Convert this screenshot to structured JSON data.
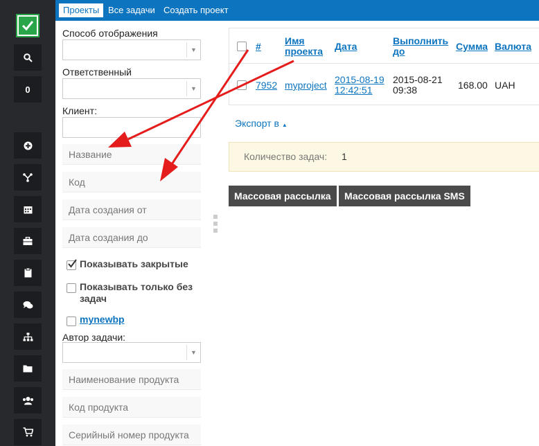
{
  "sidebar": {
    "counter": "0",
    "icons": [
      "check-logo-icon",
      "search-icon",
      "plus-circle-icon",
      "fork-icon",
      "calendar-icon",
      "briefcase-icon",
      "clipboard-icon",
      "chat-icon",
      "sitemap-icon",
      "folder-icon",
      "users-icon",
      "cart-icon"
    ]
  },
  "tabs": [
    {
      "label": "Проекты"
    },
    {
      "label": "Все задачи"
    },
    {
      "label": "Создать проект"
    }
  ],
  "filters": {
    "display_mode_label": "Способ отображения",
    "responsible_label": "Ответственный",
    "client_label": "Клиент:",
    "name_placeholder": "Название",
    "code_placeholder": "Код",
    "created_from_placeholder": "Дата создания от",
    "created_to_placeholder": "Дата создания до",
    "show_closed_label": "Показывать закрытые",
    "show_closed_checked": true,
    "show_no_tasks_label": "Показывать только без задач",
    "show_no_tasks_checked": false,
    "mynewbp_label": "mynewbp",
    "mynewbp_checked": false,
    "task_author_label": "Автор задачи:",
    "product_name_placeholder": "Наименование продукта",
    "product_code_placeholder": "Код продукта",
    "serial_placeholder": "Серийный номер продукта"
  },
  "table": {
    "headers": {
      "num": "#",
      "name_l1": "Имя",
      "name_l2": "проекта",
      "date": "Дата",
      "due_l1": "Выполнить",
      "due_l2": "до",
      "sum": "Сумма",
      "currency": "Валюта"
    },
    "rows": [
      {
        "num": "7952",
        "name": "myproject",
        "date_l1": "2015-08-19",
        "date_l2": "12:42:51",
        "due_l1": "2015-08-21",
        "due_l2": "09:38",
        "sum": "168.00",
        "currency": "UAH"
      }
    ]
  },
  "export_label": "Экспорт в",
  "task_count_label": "Количество задач:",
  "task_count_value": "1",
  "buttons": {
    "mass_mail": "Массовая рассылка",
    "mass_sms": "Массовая рассылка SMS"
  },
  "colors": {
    "accent": "#0d74bf",
    "sidebar": "#27292d",
    "annotation_arrow": "#e51c1c",
    "logo": "#2aa54a"
  }
}
